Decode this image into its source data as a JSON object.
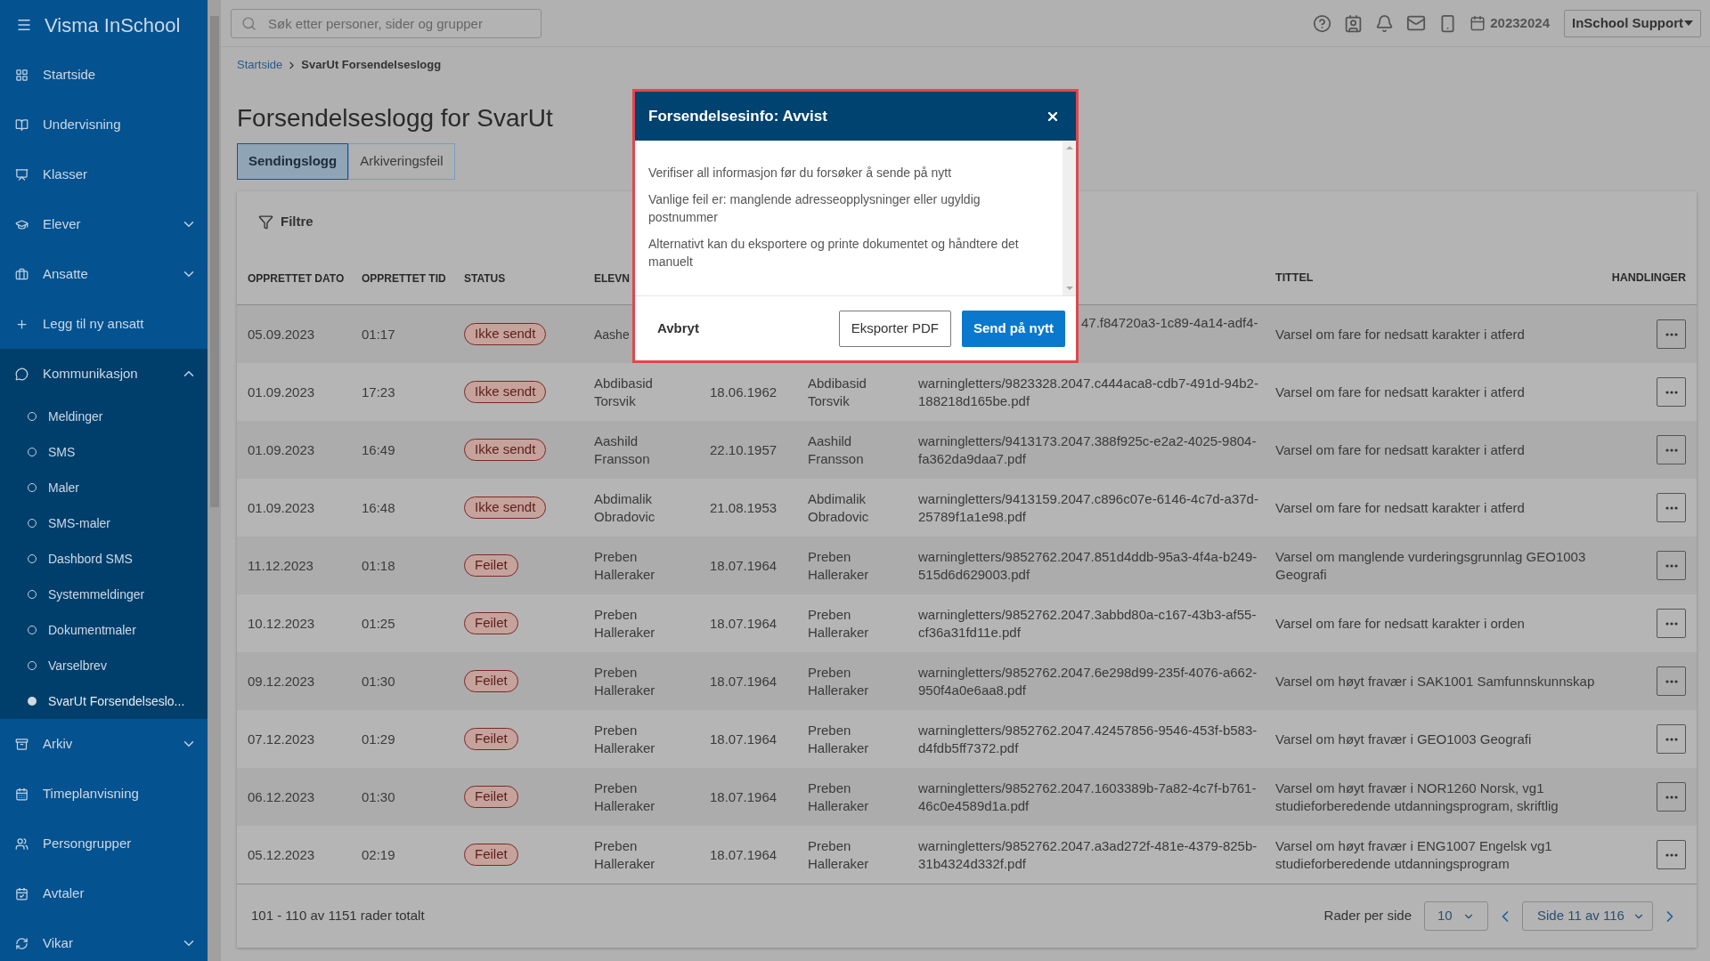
{
  "app": {
    "title": "Visma InSchool"
  },
  "sidebar": {
    "items": [
      {
        "label": "Startside"
      },
      {
        "label": "Undervisning"
      },
      {
        "label": "Klasser"
      },
      {
        "label": "Elever",
        "expanded": false
      },
      {
        "label": "Ansatte",
        "expanded": false
      },
      {
        "label": "Legg til ny ansatt"
      },
      {
        "label": "Kommunikasjon",
        "expanded": true,
        "children": [
          {
            "label": "Meldinger",
            "selected": false
          },
          {
            "label": "SMS",
            "selected": false
          },
          {
            "label": "Maler",
            "selected": false
          },
          {
            "label": "SMS-maler",
            "selected": false
          },
          {
            "label": "Dashbord SMS",
            "selected": false
          },
          {
            "label": "Systemmeldinger",
            "selected": false
          },
          {
            "label": "Dokumentmaler",
            "selected": false
          },
          {
            "label": "Varselbrev",
            "selected": false
          },
          {
            "label": "SvarUt Forsendelseslo...",
            "selected": true
          }
        ]
      },
      {
        "label": "Arkiv",
        "expanded": false
      },
      {
        "label": "Timeplanvisning"
      },
      {
        "label": "Persongrupper"
      },
      {
        "label": "Avtaler"
      },
      {
        "label": "Vikar",
        "expanded": false
      }
    ]
  },
  "topbar": {
    "search": {
      "placeholder": "Søk etter personer, sider og grupper"
    },
    "school_year": "20232024",
    "user": "InSchool Support"
  },
  "breadcrumb": [
    "Startside",
    "SvarUt Forsendelseslogg"
  ],
  "page_title": "Forsendelseslogg for SvarUt",
  "tabs": [
    {
      "label": "Sendingslogg",
      "selected": true
    },
    {
      "label": "Arkiveringsfeil",
      "selected": false
    }
  ],
  "filter": "Filtre",
  "table": {
    "columns_left": [
      "OPPRETTET DATO",
      "OPPRETTET TID",
      "STATUS",
      "ELEVN"
    ],
    "columns_right": [
      "TITTEL",
      "HANDLINGER"
    ],
    "rows": [
      {
        "date": "05.09.2023",
        "time": "01:17",
        "status": "Ikke sendt",
        "student": "Aashe",
        "file": "47.f84720a3-1c89-4a14-adf4-",
        "title": "Varsel om fare for nedsatt karakter i atferd",
        "covered": true
      },
      {
        "date": "01.09.2023",
        "time": "17:23",
        "status": "Ikke sendt",
        "student": "Abdibasid Torsvik",
        "birth": "18.06.1962",
        "recipient": "Abdibasid Torsvik",
        "file": "warningletters/9823328.2047.c444aca8-cdb7-491d-94b2-188218d165be.pdf",
        "title": "Varsel om fare for nedsatt karakter i atferd",
        "covered": false
      },
      {
        "date": "01.09.2023",
        "time": "16:49",
        "status": "Ikke sendt",
        "student": "Aashild Fransson",
        "birth": "22.10.1957",
        "recipient": "Aashild Fransson",
        "file": "warningletters/9413173.2047.388f925c-e2a2-4025-9804-fa362da9daa7.pdf",
        "title": "Varsel om fare for nedsatt karakter i atferd",
        "covered": false
      },
      {
        "date": "01.09.2023",
        "time": "16:48",
        "status": "Ikke sendt",
        "student": "Abdimalik Obradovic",
        "birth": "21.08.1953",
        "recipient": "Abdimalik Obradovic",
        "file": "warningletters/9413159.2047.c896c07e-6146-4c7d-a37d-25789f1a1e98.pdf",
        "title": "Varsel om fare for nedsatt karakter i atferd",
        "covered": false
      },
      {
        "date": "11.12.2023",
        "time": "01:18",
        "status": "Feilet",
        "student": "Preben Halleraker",
        "birth": "18.07.1964",
        "recipient": "Preben Halleraker",
        "file": "warningletters/9852762.2047.851d4ddb-95a3-4f4a-b249-515d6d629003.pdf",
        "title": "Varsel om manglende vurderingsgrunnlag GEO1003 Geografi",
        "covered": false
      },
      {
        "date": "10.12.2023",
        "time": "01:25",
        "status": "Feilet",
        "student": "Preben Halleraker",
        "birth": "18.07.1964",
        "recipient": "Preben Halleraker",
        "file": "warningletters/9852762.2047.3abbd80a-c167-43b3-af55-cf36a31fd11e.pdf",
        "title": "Varsel om fare for nedsatt karakter i orden",
        "covered": false
      },
      {
        "date": "09.12.2023",
        "time": "01:30",
        "status": "Feilet",
        "student": "Preben Halleraker",
        "birth": "18.07.1964",
        "recipient": "Preben Halleraker",
        "file": "warningletters/9852762.2047.6e298d99-235f-4076-a662-950f4a0e6aa8.pdf",
        "title": "Varsel om høyt fravær i SAK1001 Samfunnskunnskap",
        "covered": false
      },
      {
        "date": "07.12.2023",
        "time": "01:29",
        "status": "Feilet",
        "student": "Preben Halleraker",
        "birth": "18.07.1964",
        "recipient": "Preben Halleraker",
        "file": "warningletters/9852762.2047.42457856-9546-453f-b583-d4fdb5ff7372.pdf",
        "title": "Varsel om høyt fravær i GEO1003 Geografi",
        "covered": false
      },
      {
        "date": "06.12.2023",
        "time": "01:30",
        "status": "Feilet",
        "student": "Preben Halleraker",
        "birth": "18.07.1964",
        "recipient": "Preben Halleraker",
        "file": "warningletters/9852762.2047.1603389b-7a82-4c7f-b761-46c0e4589d1a.pdf",
        "title": "Varsel om høyt fravær i NOR1260 Norsk, vg1 studieforberedende utdanningsprogram, skriftlig",
        "covered": false
      },
      {
        "date": "05.12.2023",
        "time": "02:19",
        "status": "Feilet",
        "student": "Preben Halleraker",
        "birth": "18.07.1964",
        "recipient": "Preben Halleraker",
        "file": "warningletters/9852762.2047.a3ad272f-481e-4379-825b-31b4324d332f.pdf",
        "title": "Varsel om høyt fravær i ENG1007 Engelsk vg1 studieforberedende utdanningsprogram",
        "covered": false
      }
    ],
    "total": "101 - 110 av 1151 rader totalt",
    "rows_per_page_label": "Rader per side",
    "rows_per_page": "10",
    "page": "Side 11 av 116"
  },
  "dialog": {
    "title": "Forsendelsesinfo: Avvist",
    "paragraphs": [
      "Verifiser all informasjon før du forsøker å sende på nytt",
      "Vanlige feil er: manglende adresseopplysninger eller ugyldig postnummer",
      "Alternativt kan du eksportere og printe dokumentet og håndtere det manuelt"
    ],
    "buttons": [
      {
        "label": "Avbryt",
        "kind": "link"
      },
      {
        "label": "Eksporter PDF",
        "kind": "outline"
      },
      {
        "label": "Send på nytt",
        "kind": "primary"
      }
    ]
  }
}
